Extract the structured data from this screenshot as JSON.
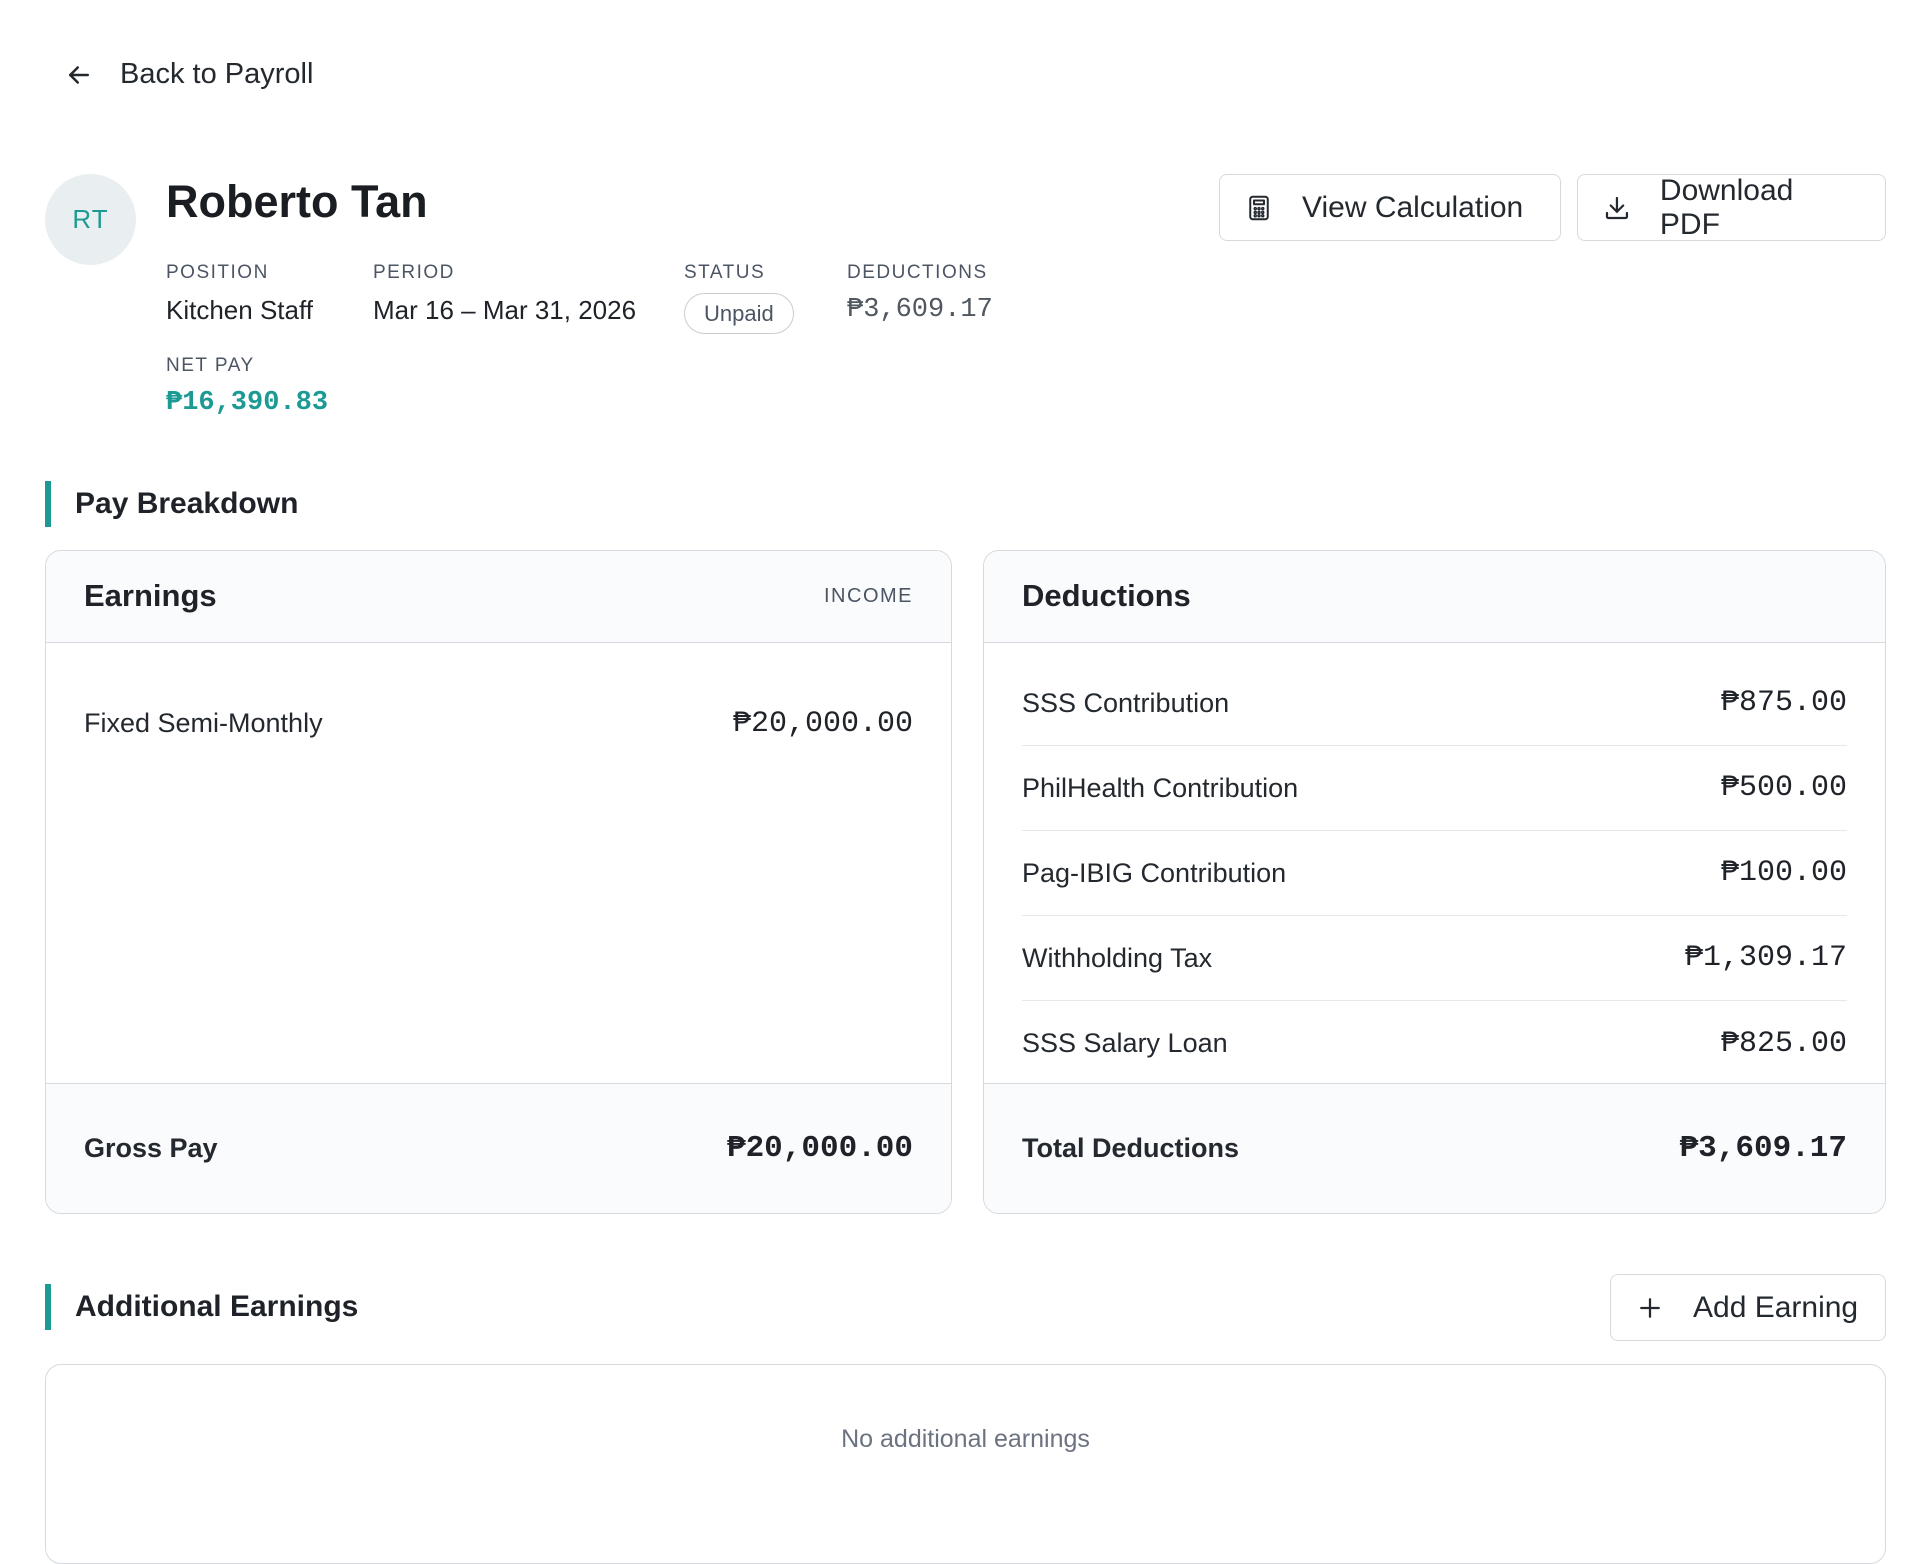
{
  "nav": {
    "back_label": "Back to Payroll"
  },
  "employee": {
    "initials": "RT",
    "name": "Roberto Tan",
    "position_label": "POSITION",
    "position": "Kitchen Staff",
    "period_label": "PERIOD",
    "period": "Mar 16 – Mar 31, 2026",
    "status_label": "STATUS",
    "status": "Unpaid",
    "deductions_label": "DEDUCTIONS",
    "deductions": "₱3,609.17",
    "net_pay_label": "NET PAY",
    "net_pay": "₱16,390.83"
  },
  "actions": {
    "view_calculation": "View Calculation",
    "download_pdf": "Download PDF"
  },
  "breakdown": {
    "title": "Pay Breakdown",
    "earnings": {
      "title": "Earnings",
      "tag": "INCOME",
      "items": [
        {
          "label": "Fixed Semi-Monthly",
          "amount": "₱20,000.00"
        }
      ],
      "total_label": "Gross Pay",
      "total": "₱20,000.00"
    },
    "deductions": {
      "title": "Deductions",
      "items": [
        {
          "label": "SSS Contribution",
          "amount": "₱875.00"
        },
        {
          "label": "PhilHealth Contribution",
          "amount": "₱500.00"
        },
        {
          "label": "Pag-IBIG Contribution",
          "amount": "₱100.00"
        },
        {
          "label": "Withholding Tax",
          "amount": "₱1,309.17"
        },
        {
          "label": "SSS Salary Loan",
          "amount": "₱825.00"
        }
      ],
      "total_label": "Total Deductions",
      "total": "₱3,609.17"
    }
  },
  "additional": {
    "title": "Additional Earnings",
    "add_label": "Add Earning",
    "empty_text": "No additional earnings"
  },
  "colors": {
    "accent": "#1c9a93",
    "border": "#d6dade"
  }
}
